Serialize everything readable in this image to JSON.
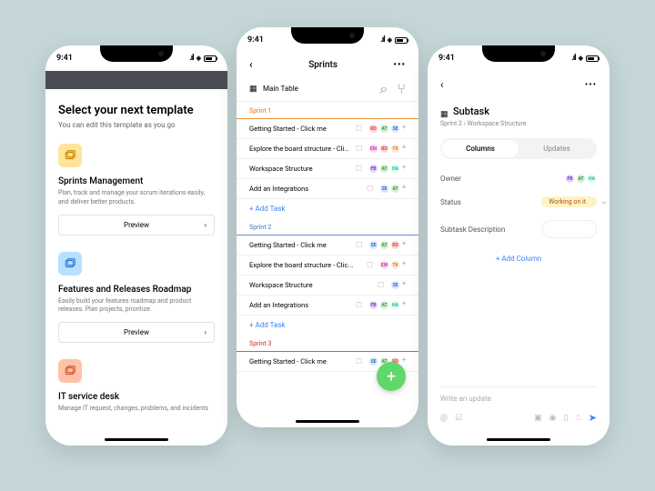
{
  "status": {
    "time": "9:41"
  },
  "phone1": {
    "title": "Select your next template",
    "subtitle": "You can edit this template as you go",
    "preview": "Preview",
    "templates": [
      {
        "name": "Sprints Management",
        "desc": "Plan, track and manage your scrum iterations easily, and deliver better products."
      },
      {
        "name": "Features and Releases Roadmap",
        "desc": "Easily build your features roadmap and product releases. Plan projects, prioritize."
      },
      {
        "name": "IT service desk",
        "desc": "Manage IT request, changes, problems, and incidents"
      }
    ]
  },
  "phone2": {
    "title": "Sprints",
    "view": "Main Table",
    "add_task": "+  Add Task",
    "sprints": [
      {
        "name": "Sprint 1",
        "cls": "s1",
        "rows": [
          {
            "name": "Getting Started - Click me",
            "av": [
              "RD",
              "AT",
              "SE"
            ],
            "more": true
          },
          {
            "name": "Explore the board structure - Clic...",
            "av": [
              "EM",
              "RD",
              "TK"
            ],
            "more": true
          },
          {
            "name": "Workspace Structure",
            "av": [
              "FB",
              "AT",
              "HA"
            ],
            "more": true
          },
          {
            "name": "Add an Integrations",
            "av": [
              "SE",
              "AT"
            ],
            "more": true
          }
        ]
      },
      {
        "name": "Sprint 2",
        "cls": "s2",
        "rows": [
          {
            "name": "Getting Started - Click me",
            "av": [
              "SE",
              "AT",
              "RD"
            ],
            "more": true
          },
          {
            "name": "Explore the board structure - Clic...",
            "av": [
              "EM",
              "TK"
            ],
            "more": true
          },
          {
            "name": "Workspace Structure",
            "av": [
              "SE"
            ],
            "more": true
          },
          {
            "name": "Add an Integrations",
            "av": [
              "FB",
              "AT",
              "HA"
            ],
            "more": true
          }
        ]
      },
      {
        "name": "Sprint 3",
        "cls": "s3",
        "rows": [
          {
            "name": "Getting Started - Click me",
            "av": [
              "SE",
              "AT",
              "RD"
            ],
            "more": true
          }
        ]
      }
    ]
  },
  "phone3": {
    "title": "Subtask",
    "breadcrumb": "Sprint 2  ›  Workspace Structure",
    "tabs": {
      "columns": "Columns",
      "updates": "Updates"
    },
    "owner": {
      "label": "Owner",
      "av": [
        "FB",
        "AT",
        "HA"
      ]
    },
    "status": {
      "label": "Status",
      "value": "Working on it"
    },
    "desc_label": "Subtask Description",
    "add_column": "+  Add Column",
    "composer_placeholder": "Write an update"
  }
}
